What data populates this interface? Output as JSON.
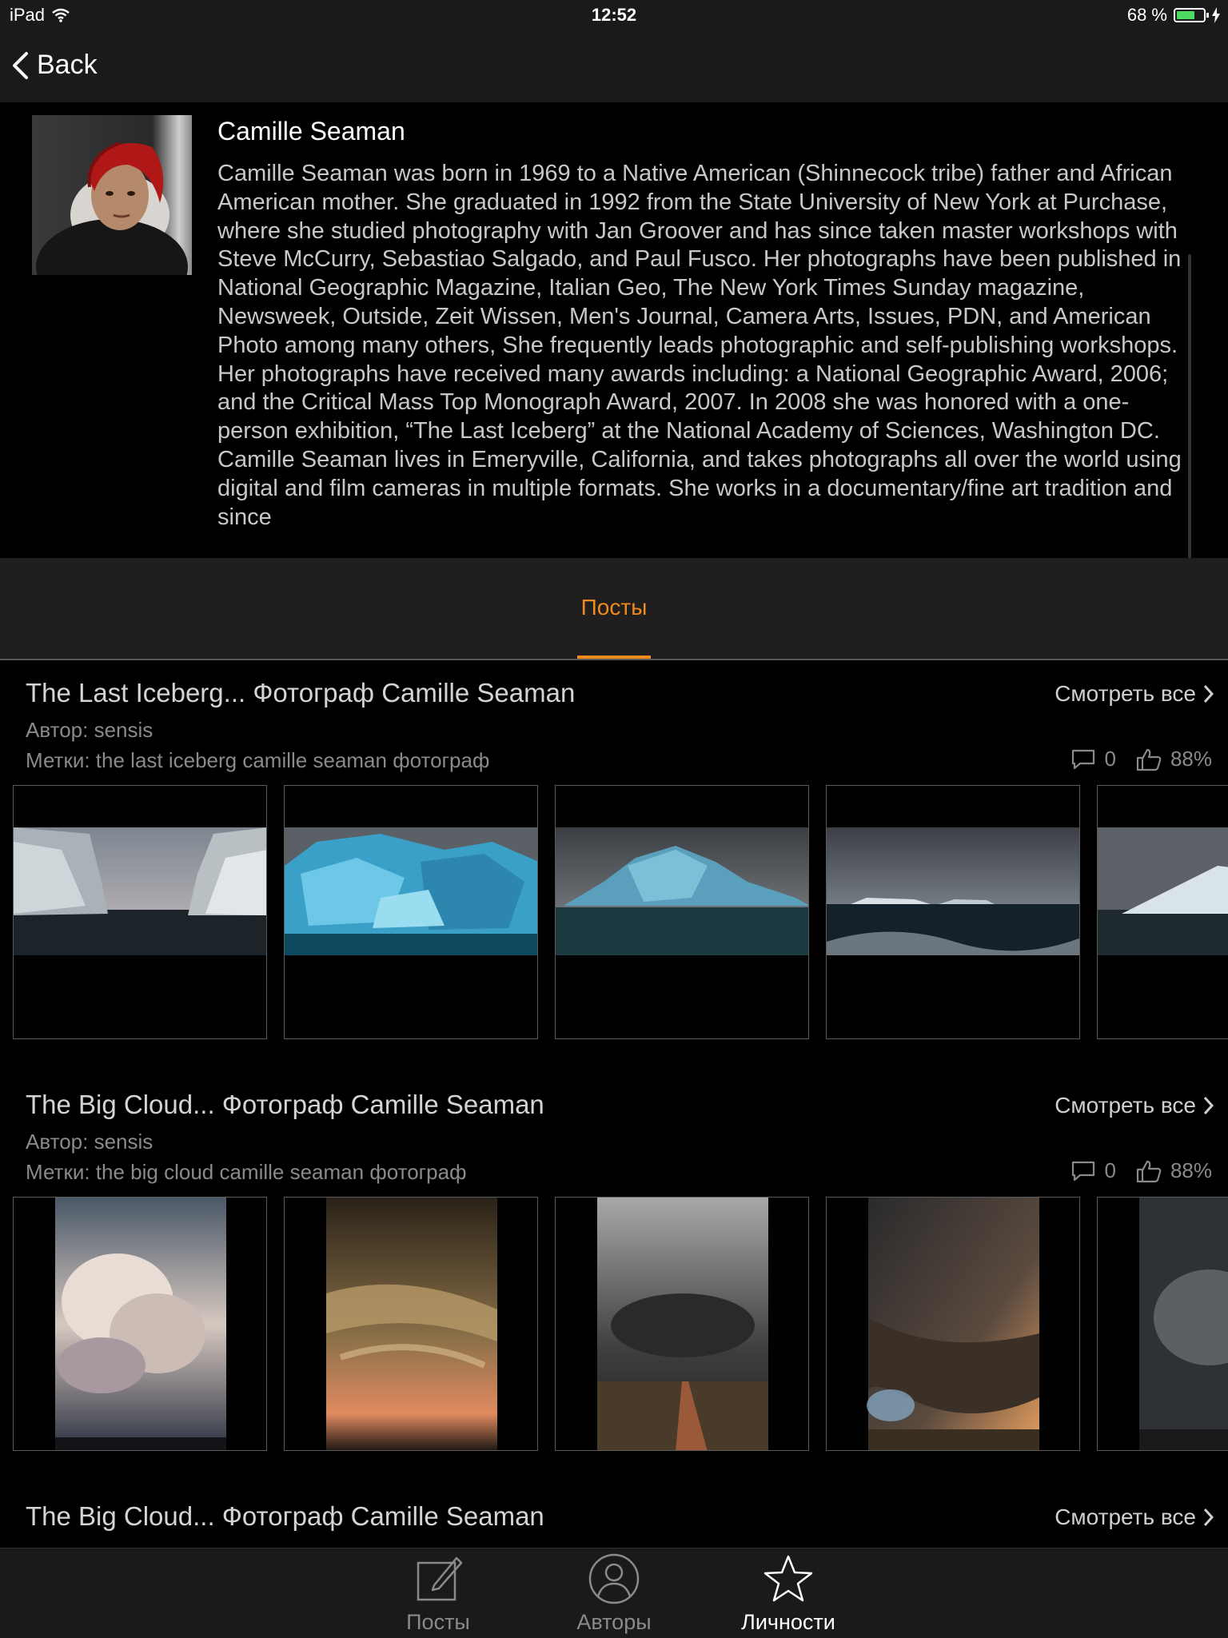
{
  "status": {
    "device": "iPad",
    "time": "12:52",
    "battery_text": "68 %",
    "battery_level": 0.68
  },
  "nav": {
    "back_label": "Back"
  },
  "profile": {
    "name": "Camille Seaman",
    "bio": "Camille Seaman was born in 1969 to a Native American (Shinnecock tribe) father and African American mother. She graduated in 1992 from the State University of New York at Purchase, where she studied photography with Jan Groover and has since taken master workshops with Steve McCurry, Sebastiao Salgado, and Paul Fusco. Her photographs have been published in National Geographic Magazine, Italian Geo, The New York Times Sunday magazine, Newsweek, Outside, Zeit Wissen, Men's Journal, Camera Arts, Issues, PDN, and American Photo among many others, She frequently leads photographic and self-publishing workshops. Her photographs have received many awards including: a National Geographic Award, 2006; and the Critical Mass Top Monograph Award, 2007. In 2008 she was honored with a one-person exhibition, “The Last Iceberg” at the National Academy of Sciences, Washington DC. Camille Seaman lives in Emeryville, California, and takes photographs all over the world using digital and film cameras in multiple formats. She works in a documentary/fine art tradition and since"
  },
  "tabs": {
    "active": "Посты"
  },
  "posts": [
    {
      "title": "The Last Iceberg... Фотограф Camille Seaman",
      "see_all": "Смотреть все",
      "author": "Автор: sensis",
      "tags": "Метки: the last iceberg camille seaman фотограф",
      "comments": "0",
      "likes": "88%"
    },
    {
      "title": "The Big Cloud... Фотограф Camille Seaman",
      "see_all": "Смотреть все",
      "author": "Автор: sensis",
      "tags": "Метки: the big cloud camille seaman фотограф",
      "comments": "0",
      "likes": "88%"
    },
    {
      "title": "The Big Cloud... Фотограф Camille Seaman",
      "see_all": "Смотреть все"
    }
  ],
  "tabbar": {
    "items": [
      {
        "label": "Посты",
        "icon": "compose-icon",
        "active": false
      },
      {
        "label": "Авторы",
        "icon": "person-icon",
        "active": false
      },
      {
        "label": "Личности",
        "icon": "star-icon",
        "active": true
      }
    ]
  },
  "colors": {
    "accent": "#f08a1c",
    "background": "#000000",
    "bar": "#1a1a1a"
  }
}
